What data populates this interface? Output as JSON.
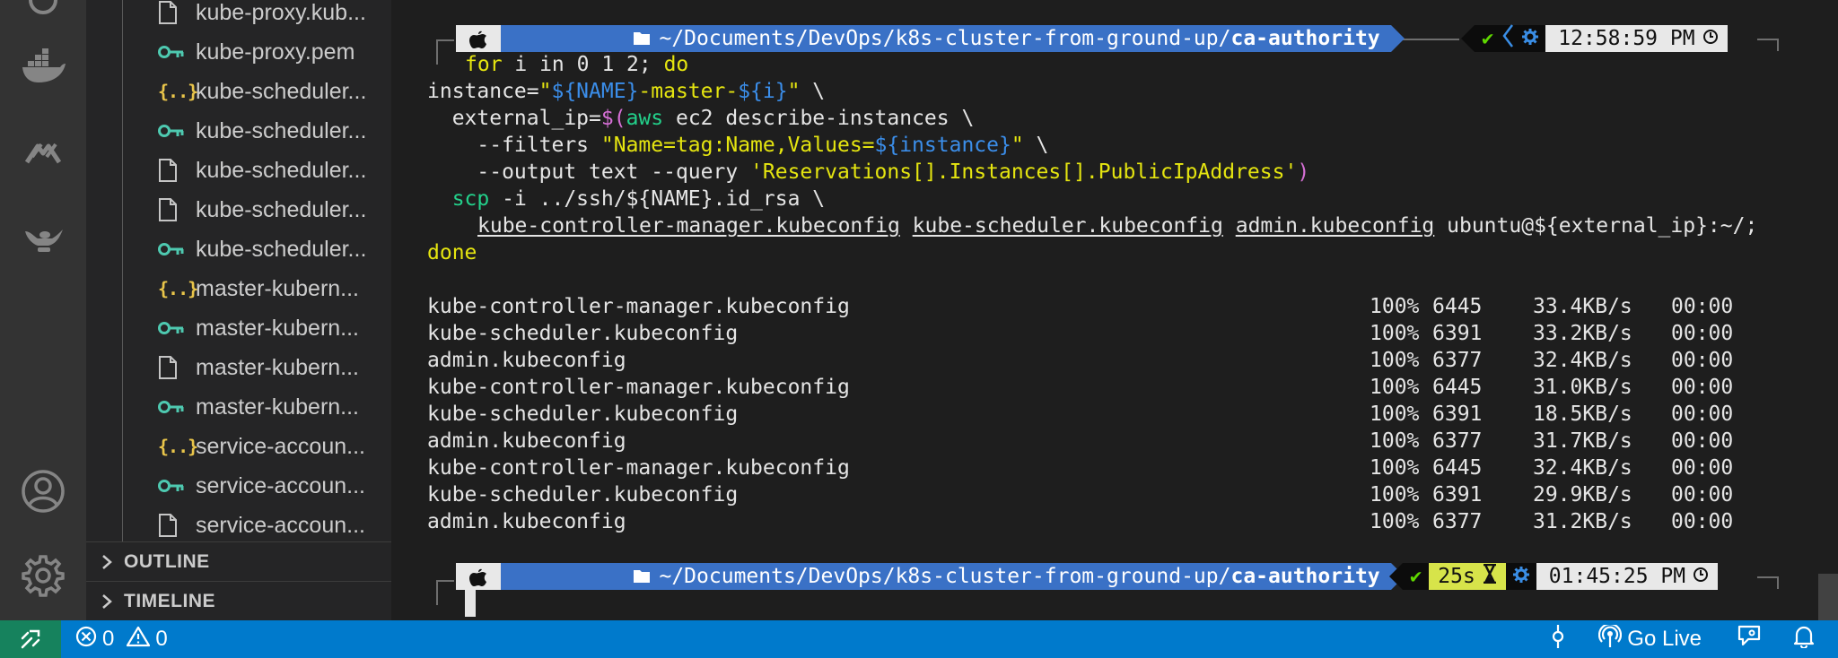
{
  "explorer": {
    "files": [
      {
        "label": "kube-proxy.kub...",
        "icon": "file-icon"
      },
      {
        "label": "kube-proxy.pem",
        "icon": "key-icon"
      },
      {
        "label": "kube-scheduler...",
        "icon": "json-icon"
      },
      {
        "label": "kube-scheduler...",
        "icon": "key-icon"
      },
      {
        "label": "kube-scheduler...",
        "icon": "file-icon"
      },
      {
        "label": "kube-scheduler...",
        "icon": "file-icon"
      },
      {
        "label": "kube-scheduler...",
        "icon": "key-icon"
      },
      {
        "label": "master-kubern...",
        "icon": "json-icon"
      },
      {
        "label": "master-kubern...",
        "icon": "key-icon"
      },
      {
        "label": "master-kubern...",
        "icon": "file-icon"
      },
      {
        "label": "master-kubern...",
        "icon": "key-icon"
      },
      {
        "label": "service-accoun...",
        "icon": "json-icon"
      },
      {
        "label": "service-accoun...",
        "icon": "key-icon"
      },
      {
        "label": "service-accoun...",
        "icon": "file-icon"
      }
    ],
    "json_glyph": "{..}",
    "outline_label": "OUTLINE",
    "timeline_label": "TIMELINE"
  },
  "terminal": {
    "prompt1": {
      "path_prefix": "~/Documents/DevOps/k8s-cluster-from-ground-up/",
      "path_dir": "ca-authority",
      "status_check": "✔",
      "time": "12:58:59 PM"
    },
    "command": {
      "l1_kw1": "for",
      "l1_mid": " i in 0 1 2; ",
      "l1_kw2": "do",
      "l2_a": "instance=",
      "l2_q1": "\"",
      "l2_var1": "${NAME}",
      "l2_lit": "-master-",
      "l2_var2": "${i}",
      "l2_q2": "\"",
      "l2_end": " \\",
      "l3_a": "  external_ip=",
      "l3_sub": "$(",
      "l3_aws": "aws",
      "l3_rest": " ec2 describe-instances \\",
      "l4_a": "    --filters ",
      "l4_str1": "\"Name=tag:Name,Values=",
      "l4_var": "${instance}",
      "l4_str2": "\"",
      "l4_end": " \\",
      "l5_a": "    --output text --query ",
      "l5_str": "'Reservations[].Instances[].PublicIpAddress'",
      "l5_close": ")",
      "l6_scp": "  scp",
      "l6_rest": " -i ../ssh/${NAME}.id_rsa \\",
      "l7_f1": "kube-controller-manager.kubeconfig",
      "l7_f2": "kube-scheduler.kubeconfig",
      "l7_f3": "admin.kubeconfig",
      "l7_dest": "ubuntu@${external_ip}:~/;",
      "l8_done": "done"
    },
    "transfers": [
      {
        "file": "kube-controller-manager.kubeconfig",
        "pct": "100%",
        "size": "6445",
        "rate": "33.4KB/s",
        "time": "00:00"
      },
      {
        "file": "kube-scheduler.kubeconfig",
        "pct": "100%",
        "size": "6391",
        "rate": "33.2KB/s",
        "time": "00:00"
      },
      {
        "file": "admin.kubeconfig",
        "pct": "100%",
        "size": "6377",
        "rate": "32.4KB/s",
        "time": "00:00"
      },
      {
        "file": "kube-controller-manager.kubeconfig",
        "pct": "100%",
        "size": "6445",
        "rate": "31.0KB/s",
        "time": "00:00"
      },
      {
        "file": "kube-scheduler.kubeconfig",
        "pct": "100%",
        "size": "6391",
        "rate": "18.5KB/s",
        "time": "00:00"
      },
      {
        "file": "admin.kubeconfig",
        "pct": "100%",
        "size": "6377",
        "rate": "31.7KB/s",
        "time": "00:00"
      },
      {
        "file": "kube-controller-manager.kubeconfig",
        "pct": "100%",
        "size": "6445",
        "rate": "32.4KB/s",
        "time": "00:00"
      },
      {
        "file": "kube-scheduler.kubeconfig",
        "pct": "100%",
        "size": "6391",
        "rate": "29.9KB/s",
        "time": "00:00"
      },
      {
        "file": "admin.kubeconfig",
        "pct": "100%",
        "size": "6377",
        "rate": "31.2KB/s",
        "time": "00:00"
      }
    ],
    "prompt2": {
      "path_prefix": "~/Documents/DevOps/k8s-cluster-from-ground-up/",
      "path_dir": "ca-authority",
      "status_check": "✔",
      "duration": "25s",
      "time": "01:45:25 PM"
    }
  },
  "statusbar": {
    "errors": "0",
    "warnings": "0",
    "go_live": "Go Live"
  },
  "colors": {
    "statusbar_bg": "#007acc",
    "remote_bg": "#16825d",
    "path_segment": "#3a71c6",
    "duration_segment": "#d7e44a"
  }
}
